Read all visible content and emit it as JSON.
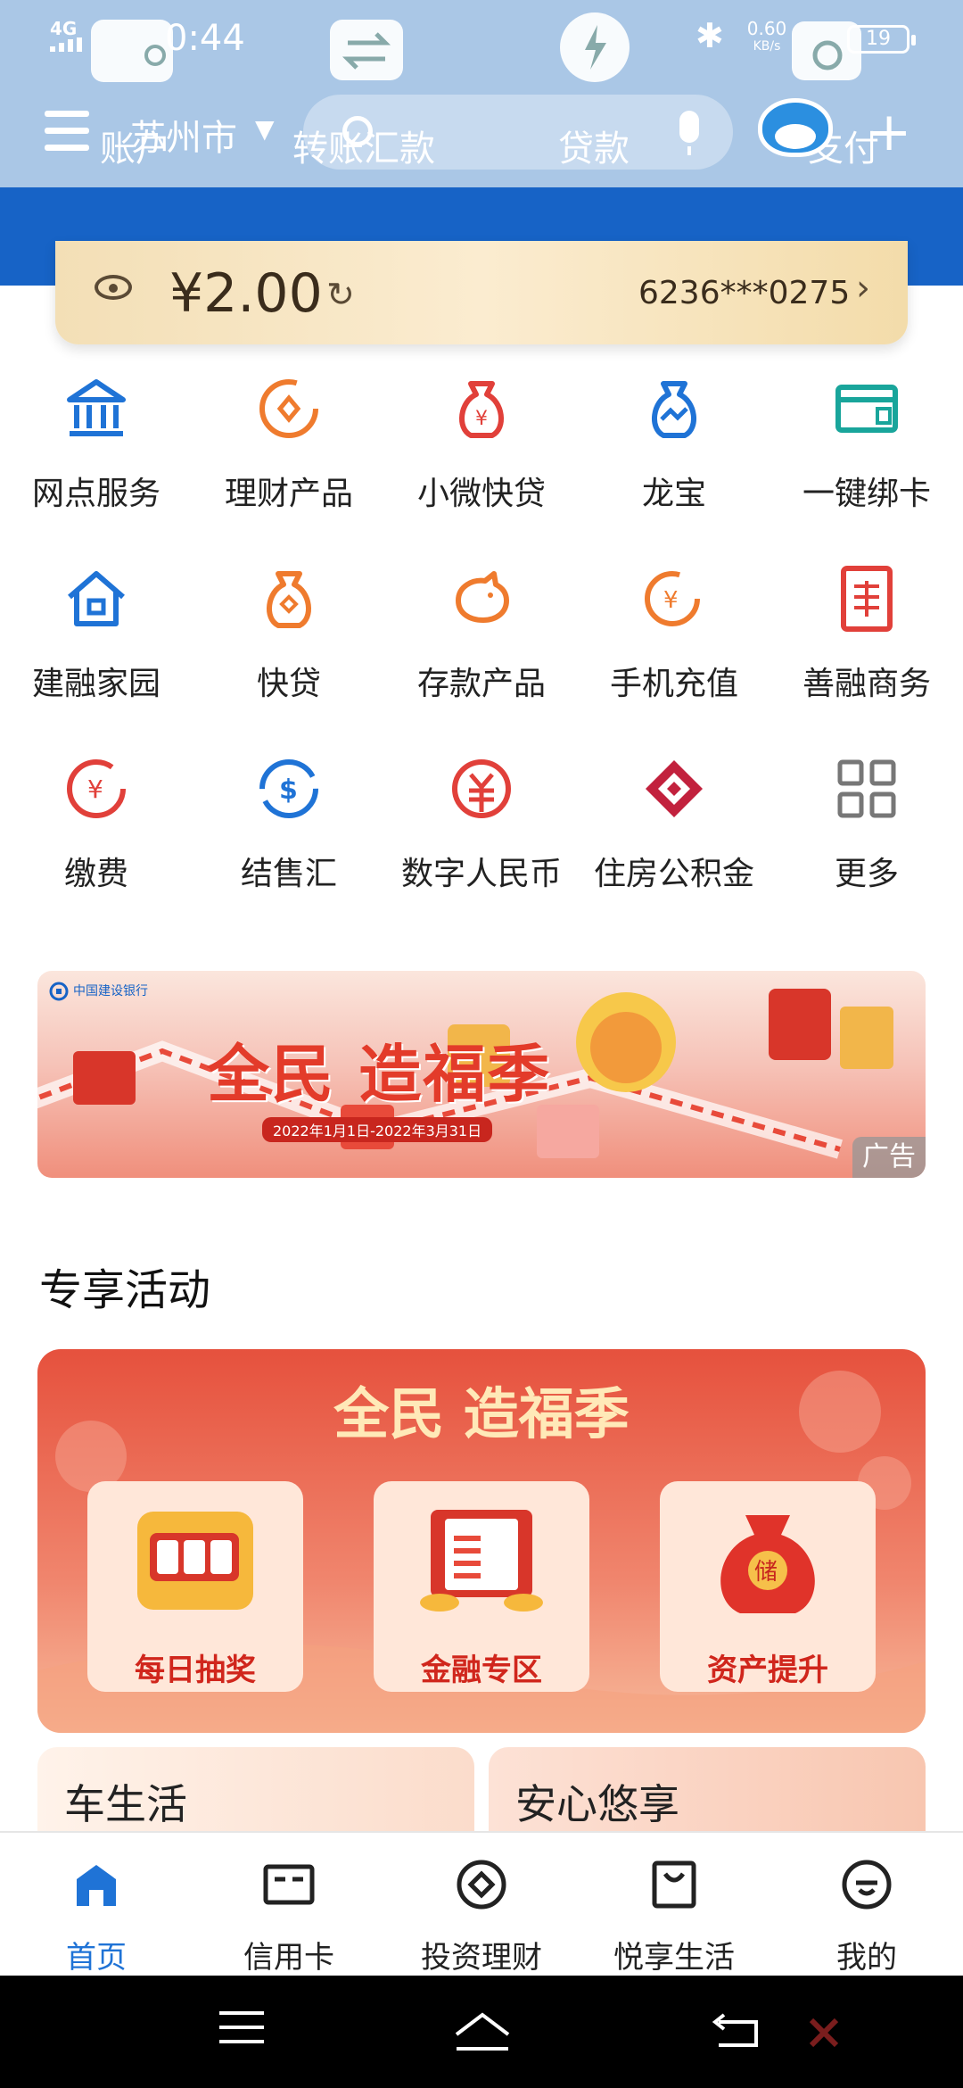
{
  "status_bar": {
    "network": "4G",
    "time": "0:44",
    "speed_value": "0.60",
    "speed_unit": "KB/s",
    "battery": "19"
  },
  "header": {
    "account_word": "账户",
    "city": "苏州市",
    "transfer": "转账汇款",
    "loan": "贷款",
    "pay": "支付"
  },
  "balance": {
    "amount": "¥2.00",
    "account_no": "6236***0275"
  },
  "quick_services": [
    {
      "label": "网点服务",
      "icon": "bank-building-icon",
      "color": "#1f73d6"
    },
    {
      "label": "理财产品",
      "icon": "wealth-coin-icon",
      "color": "#ef7b2e"
    },
    {
      "label": "小微快贷",
      "icon": "money-bag-icon",
      "color": "#e1403a"
    },
    {
      "label": "龙宝",
      "icon": "dragon-bag-icon",
      "color": "#1f73d6"
    },
    {
      "label": "一键绑卡",
      "icon": "card-bind-icon",
      "color": "#19a59b"
    },
    {
      "label": "建融家园",
      "icon": "home-icon",
      "color": "#1f73d6"
    },
    {
      "label": "快贷",
      "icon": "quick-loan-icon",
      "color": "#ef7b2e"
    },
    {
      "label": "存款产品",
      "icon": "piggy-bank-icon",
      "color": "#ef7b2e"
    },
    {
      "label": "手机充值",
      "icon": "mobile-topup-icon",
      "color": "#ef7b2e"
    },
    {
      "label": "善融商务",
      "icon": "shanrong-icon",
      "color": "#e1403a"
    },
    {
      "label": "缴费",
      "icon": "pay-bill-icon",
      "color": "#e1403a"
    },
    {
      "label": "结售汇",
      "icon": "currency-exchange-icon",
      "color": "#1f73d6"
    },
    {
      "label": "数字人民币",
      "icon": "digital-rmb-icon",
      "color": "#e1403a"
    },
    {
      "label": "住房公积金",
      "icon": "housing-fund-icon",
      "color": "#c2213d"
    },
    {
      "label": "更多",
      "icon": "more-grid-icon",
      "color": "#777777"
    }
  ],
  "banner": {
    "logo_text": "中国建设银行",
    "title": "全民 造福季",
    "date_range": "2022年1月1日-2022年3月31日",
    "ad_label": "广告"
  },
  "section": {
    "title": "专享活动"
  },
  "promo": {
    "title": "全民 造福季",
    "cards": [
      {
        "label": "每日抽奖",
        "icon": "slot-machine-icon"
      },
      {
        "label": "金融专区",
        "icon": "finance-book-icon"
      },
      {
        "label": "资产提升",
        "icon": "lucky-bag-icon"
      }
    ]
  },
  "mini_cards": [
    {
      "label": "车生活"
    },
    {
      "label": "安心悠享"
    }
  ],
  "tabs": [
    {
      "label": "首页",
      "icon": "home-tab-icon",
      "active": true
    },
    {
      "label": "信用卡",
      "icon": "credit-card-icon",
      "active": false
    },
    {
      "label": "投资理财",
      "icon": "invest-icon",
      "active": false
    },
    {
      "label": "悦享生活",
      "icon": "shopping-bag-icon",
      "active": false
    },
    {
      "label": "我的",
      "icon": "profile-icon",
      "active": false
    }
  ],
  "colors": {
    "header_bg": "#aac7e6",
    "brand_blue": "#1763c6",
    "active_tab": "#1f73d6",
    "promo_red": "#e6513d"
  }
}
